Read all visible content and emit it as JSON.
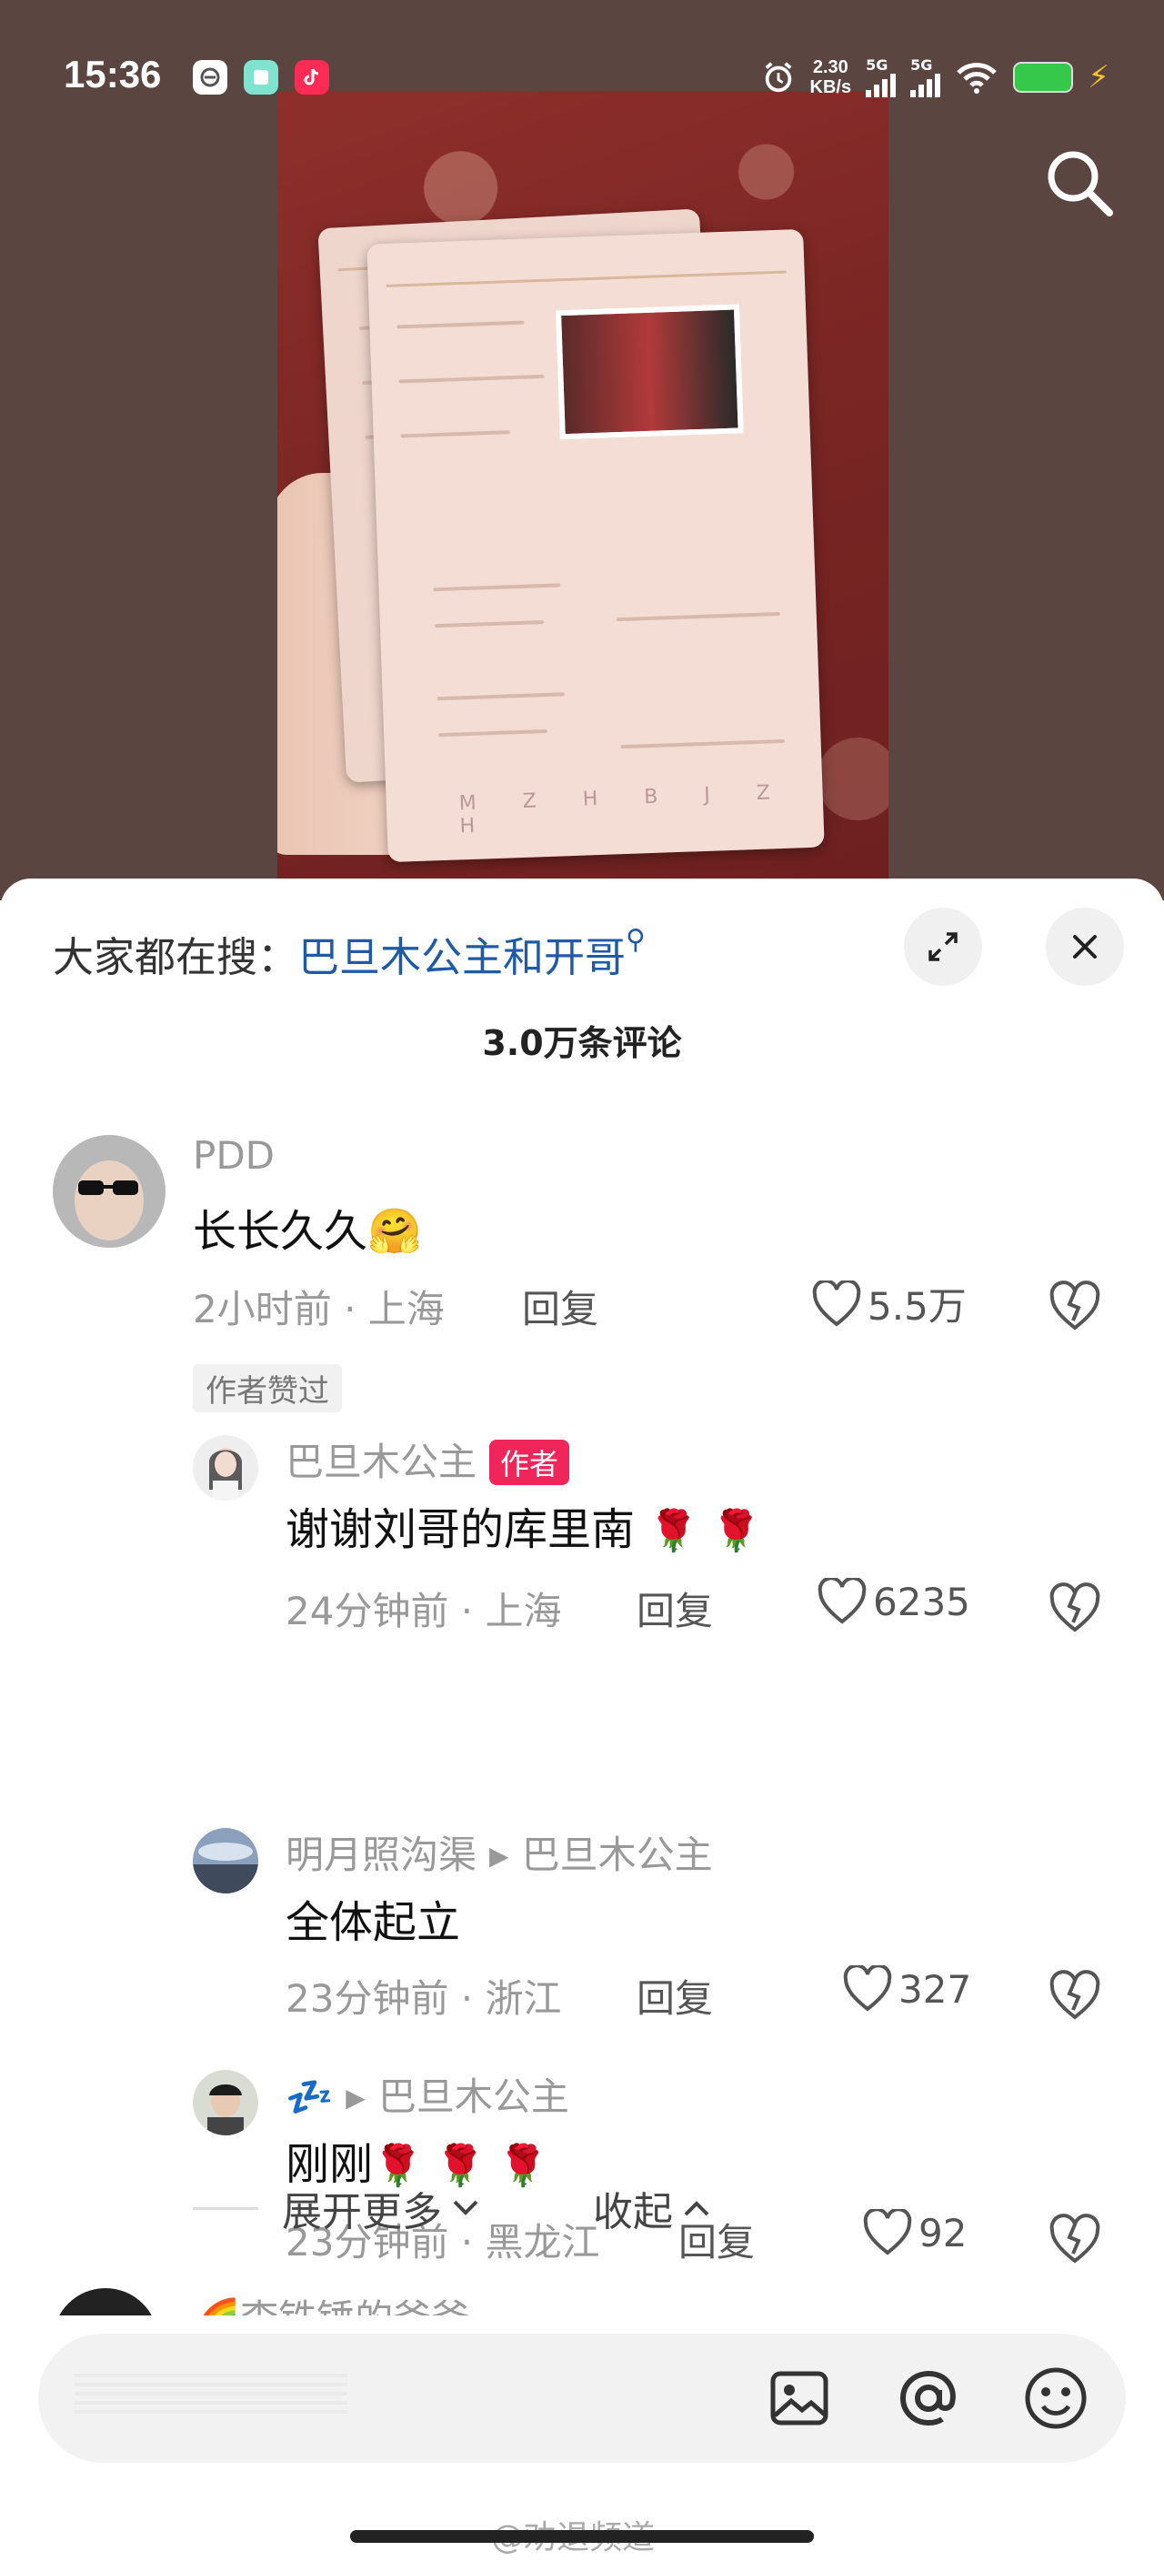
{
  "status_bar": {
    "time": "15:36",
    "net_speed_value": "2.30",
    "net_speed_unit": "KB/s",
    "signal1": "5G",
    "signal2": "5G",
    "icons": [
      "alarm-icon",
      "wifi-icon",
      "battery-icon",
      "charging-bolt-icon"
    ]
  },
  "video": {
    "cert_code": "M Z H B J Z H"
  },
  "header": {
    "hot_search_prefix": "大家都在搜：",
    "hot_search_keyword": "巴旦木公主和开哥",
    "comment_count": "3.0万条评论"
  },
  "comments": [
    {
      "user": "PDD",
      "text": "长长久久",
      "emoji": "🤗",
      "time_loc": "2小时前 · 上海",
      "reply": "回复",
      "likes": "5.5万",
      "author_liked": "作者赞过"
    }
  ],
  "replies": [
    {
      "user": "巴旦木公主",
      "badge": "作者",
      "text": "谢谢刘哥的库里南",
      "roses": "🌹 🌹",
      "time_loc": "24分钟前 · 上海",
      "reply": "回复",
      "likes": "6235"
    },
    {
      "user": "明月照沟渠",
      "reply_to": "巴旦木公主",
      "text": "全体起立",
      "time_loc": "23分钟前 · 浙江",
      "reply": "回复",
      "likes": "327"
    },
    {
      "user": "💤",
      "reply_to": "巴旦木公主",
      "text": "刚刚",
      "roses": "🌹 🌹 🌹",
      "time_loc": "23分钟前 · 黑龙江",
      "reply": "回复",
      "likes": "92"
    }
  ],
  "expand": {
    "more": "展开更多",
    "collapse": "收起"
  },
  "next_comment_user": "🌈李铁锤的爸爸",
  "watermark": "@劝退频道"
}
